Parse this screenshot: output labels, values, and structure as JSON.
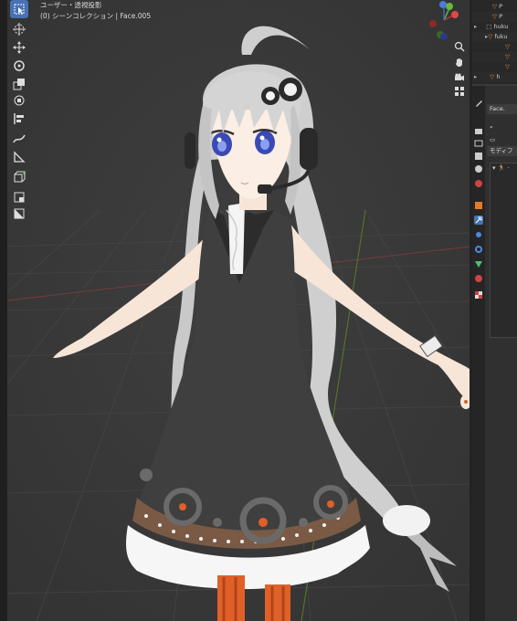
{
  "viewport": {
    "view_label": "ユーザー・透視投影",
    "collection_label": "(0) シーンコレクション | Face.005"
  },
  "outliner": {
    "rows": [
      "P",
      "P",
      "huku",
      "fuku",
      "",
      "",
      "",
      "",
      "h"
    ]
  },
  "properties": {
    "object_name": "Face.",
    "modifier_tab": "モディフ"
  },
  "icons": {
    "tools": [
      "select-box-icon",
      "cursor-icon",
      "move-icon",
      "rotate-icon",
      "scale-icon",
      "transform-icon",
      "align-icon",
      "annotate-icon",
      "measure-icon",
      "add-cube-icon",
      "extrude-icon",
      "shrink-icon"
    ],
    "nav": [
      "zoom-icon",
      "pan-hand-icon",
      "camera-icon",
      "grid-icon"
    ]
  }
}
